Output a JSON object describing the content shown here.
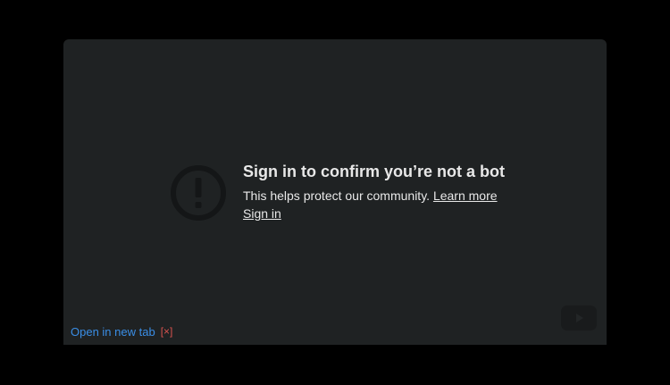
{
  "embed": {
    "title": "Sign in to confirm you’re not a bot",
    "body_text": "This helps protect our community. ",
    "learn_more_label": "Learn more",
    "sign_in_label": "Sign in",
    "icon": "alert-circle-icon",
    "logo_icon": "youtube-logo-icon"
  },
  "footer": {
    "open_new_tab_label": "Open in new tab",
    "close_label": "[×]"
  },
  "colors": {
    "page_background": "#000000",
    "player_background": "#1f2223",
    "text": "#e8e8e8",
    "link_blue": "#3a8ee6",
    "close_red": "#d9534f"
  }
}
